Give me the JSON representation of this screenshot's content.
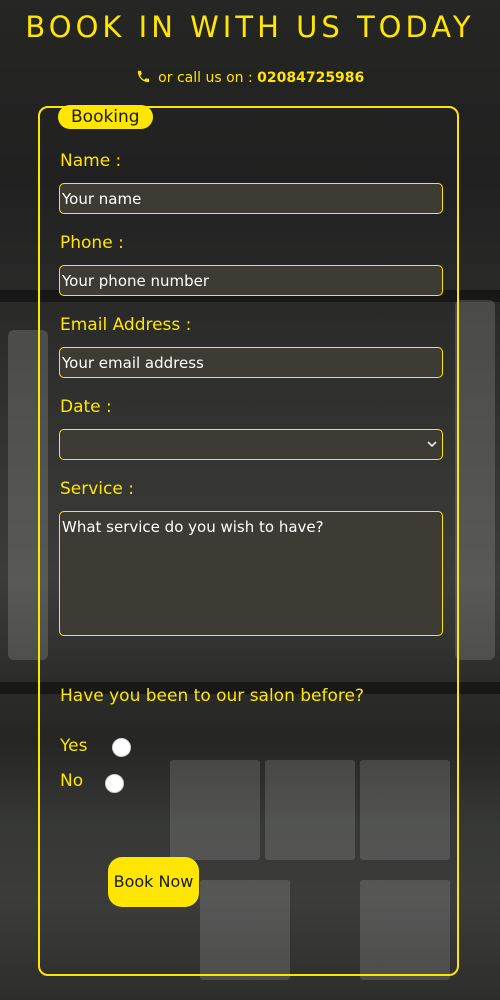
{
  "header": {
    "title": "BOOK IN WITH US TODAY",
    "call_prefix": "or call us on : ",
    "phone_number": "02084725986"
  },
  "form": {
    "legend": "Booking",
    "name_label": "Name :",
    "name_placeholder": "Your name",
    "phone_label": "Phone :",
    "phone_placeholder": "Your phone number",
    "email_label": "Email Address :",
    "email_placeholder": "Your email address",
    "date_label": "Date :",
    "date_value": "",
    "service_label": "Service :",
    "service_placeholder": "What service do you wish to have?",
    "question": "Have you been to our salon before?",
    "yes_label": "Yes",
    "no_label": "No",
    "submit_label": "Book Now"
  },
  "colors": {
    "accent": "#ffe600",
    "field_bg": "#3d3b33",
    "text": "#ffffff"
  },
  "icons": {
    "phone": "phone-icon",
    "select_chevron": "chevron-down-icon"
  }
}
